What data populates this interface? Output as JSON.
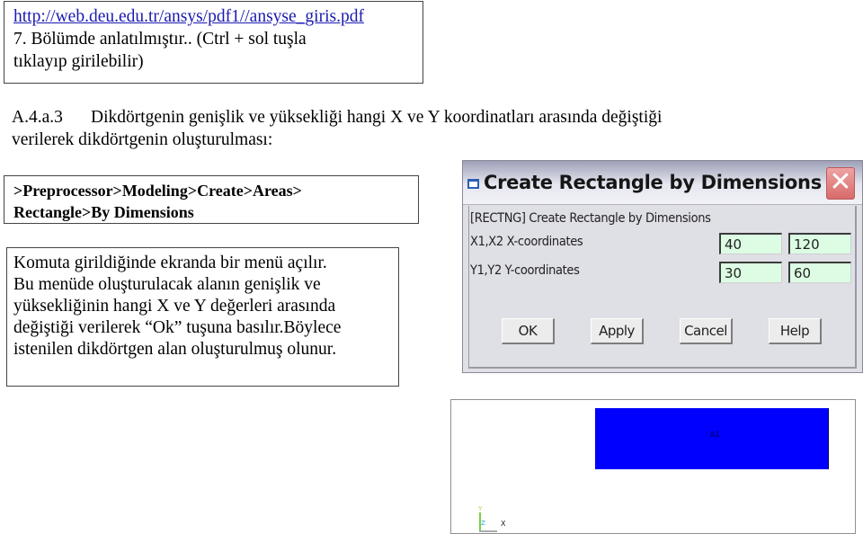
{
  "link_box": {
    "url": "http://web.deu.edu.tr/ansys/pdf1//ansyse_giris.pdf",
    "line1": "7. Bölümde anlatılmıştır.. (Ctrl + sol tuşla",
    "line2": "tıklayıp girilebilir)"
  },
  "section": {
    "number": "A.4.a.3",
    "title_line1": "Dikdörtgenin genişlik ve yüksekliği hangi X ve Y koordinatları arasında değiştiği",
    "title_line2": "verilerek dikdörtgenin oluşturulması:"
  },
  "command_path": {
    "line1": ">Preprocessor>Modeling>Create>Areas>",
    "line2": "Rectangle>By Dimensions"
  },
  "description": {
    "lines": [
      "Komuta girildiğinde ekranda bir menü açılır.",
      "Bu menüde oluşturulacak alanın genişlik ve",
      "yüksekliğinin hangi X ve Y değerleri arasında",
      "değiştiği verilerek “Ok” tuşuna basılır.Böylece",
      "istenilen dikdörtgen alan oluşturulmuş olunur."
    ]
  },
  "dialog": {
    "title": "Create Rectangle by Dimensions",
    "command_label": "[RECTNG]  Create Rectangle by Dimensions",
    "rows": [
      {
        "label": "X1,X2  X-coordinates",
        "value1": "40",
        "value2": "120"
      },
      {
        "label": "Y1,Y2  Y-coordinates",
        "value1": "30",
        "value2": "60"
      }
    ],
    "buttons": {
      "ok": "OK",
      "apply": "Apply",
      "cancel": "Cancel",
      "help": "Help"
    },
    "field_color": "#dcfde4",
    "close_symbol": "✕"
  },
  "viewport": {
    "area_label": "A1",
    "area_color": "#0000ff",
    "axis_labels": {
      "x": "X",
      "y": "Y",
      "z": "Z"
    }
  }
}
